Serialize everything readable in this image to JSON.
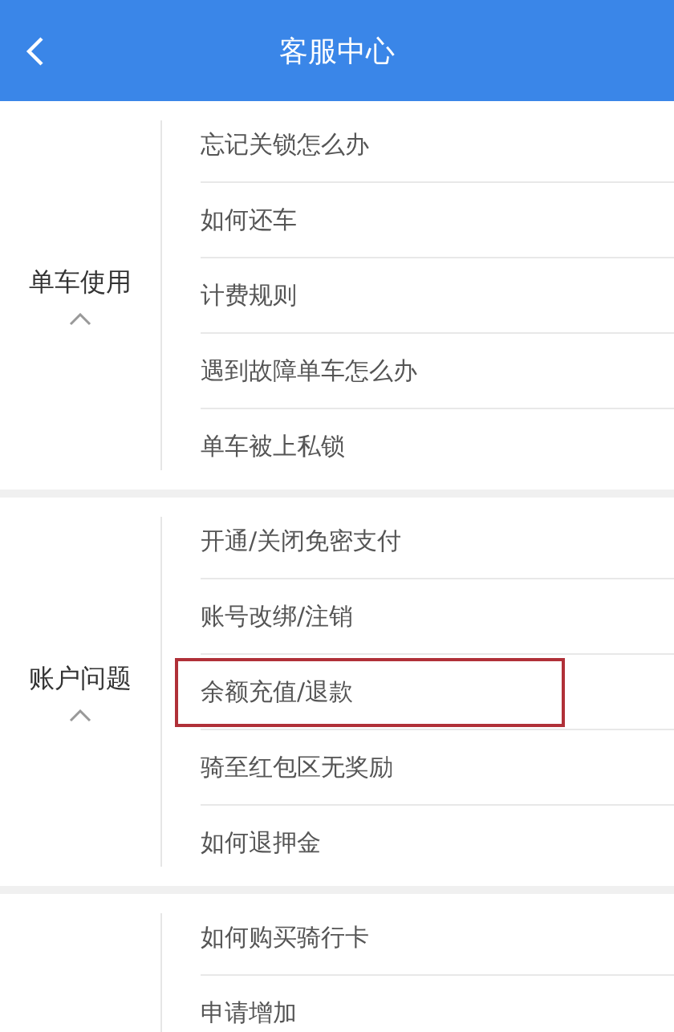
{
  "header": {
    "title": "客服中心"
  },
  "sections": [
    {
      "category": "单车使用",
      "expanded": true,
      "items": [
        {
          "label": "忘记关锁怎么办",
          "highlighted": false
        },
        {
          "label": "如何还车",
          "highlighted": false
        },
        {
          "label": "计费规则",
          "highlighted": false
        },
        {
          "label": "遇到故障单车怎么办",
          "highlighted": false
        },
        {
          "label": "单车被上私锁",
          "highlighted": false
        }
      ]
    },
    {
      "category": "账户问题",
      "expanded": true,
      "items": [
        {
          "label": "开通/关闭免密支付",
          "highlighted": false
        },
        {
          "label": "账号改绑/注销",
          "highlighted": false
        },
        {
          "label": "余额充值/退款",
          "highlighted": true
        },
        {
          "label": "骑至红包区无奖励",
          "highlighted": false
        },
        {
          "label": "如何退押金",
          "highlighted": false
        }
      ]
    },
    {
      "items": [
        {
          "label": "如何购买骑行卡",
          "highlighted": false
        },
        {
          "label": "申请增加",
          "highlighted": false
        }
      ]
    }
  ]
}
